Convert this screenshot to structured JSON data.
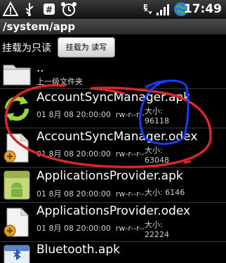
{
  "status": {
    "time": "17:49"
  },
  "path": "/system/app",
  "mount": {
    "label": "挂载为只读",
    "button": "挂载为 读写"
  },
  "parent": {
    "name": "..",
    "desc": "上一级文件夹"
  },
  "files": [
    {
      "name": "AccountSyncManager.apk",
      "date": "01 8月 08 20:00:00",
      "perm": "rw-r--r--",
      "size_label": "大小:",
      "size": "96118"
    },
    {
      "name": "AccountSyncManager.odex",
      "date": "01 8月 08 20:00:00",
      "perm": "rw-r--r--",
      "size_label": "大小:",
      "size": "63048"
    },
    {
      "name": "ApplicationsProvider.apk",
      "date": "01 8月 08 20:00:00",
      "perm": "rw-r--r--",
      "size_label": "大小:",
      "size": "6146"
    },
    {
      "name": "ApplicationsProvider.odex",
      "date": "01 8月 08 20:00:00",
      "perm": "rw-r--r--",
      "size_label": "大小:",
      "size": "22224"
    },
    {
      "name": "Bluetooth.apk"
    }
  ],
  "colors": {
    "annotation_red": "#d8262a",
    "annotation_blue": "#1a3cff"
  }
}
